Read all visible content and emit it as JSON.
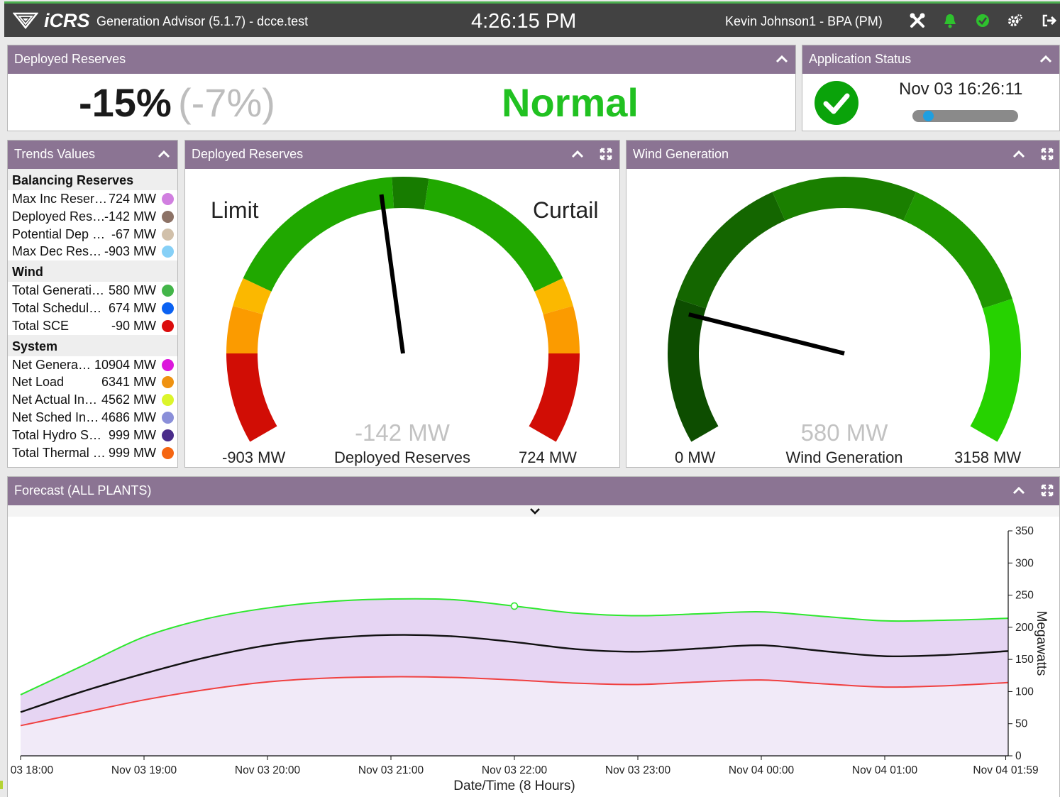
{
  "header": {
    "brand": "iCRS",
    "app_title": "Generation Advisor (5.1.7) - dcce.test",
    "clock": "4:26:15 PM",
    "user": "Kevin Johnson1 - BPA (PM)"
  },
  "deployed_summary": {
    "title": "Deployed Reserves",
    "percent": "-15%",
    "percent_paren": "(-7%)",
    "status": "Normal",
    "status_color": "#21c121"
  },
  "app_status": {
    "title": "Application Status",
    "timestamp": "Nov 03 16:26:11",
    "progress": 0.1
  },
  "trends": {
    "title": "Trends Values",
    "groups": [
      {
        "name": "Balancing Reserves",
        "rows": [
          {
            "label": "Max Inc Reser…",
            "value": "724 MW",
            "color": "#d17fe0"
          },
          {
            "label": "Deployed Res…",
            "value": "-142 MW",
            "color": "#8c7266"
          },
          {
            "label": "Potential Dep …",
            "value": "-67 MW",
            "color": "#d1c0aa"
          },
          {
            "label": "Max Dec Res…",
            "value": "-903 MW",
            "color": "#86d0f7"
          }
        ]
      },
      {
        "name": "Wind",
        "rows": [
          {
            "label": "Total Generati…",
            "value": "580 MW",
            "color": "#43b549"
          },
          {
            "label": "Total Schedul…",
            "value": "674 MW",
            "color": "#0b62f2"
          },
          {
            "label": "Total SCE",
            "value": "-90 MW",
            "color": "#db0d0d"
          }
        ]
      },
      {
        "name": "System",
        "rows": [
          {
            "label": "Net Genera…",
            "value": "10904 MW",
            "color": "#dc18dc"
          },
          {
            "label": "Net Load",
            "value": "6341 MW",
            "color": "#ef9211"
          },
          {
            "label": "Net Actual In…",
            "value": "4562 MW",
            "color": "#dcf52b"
          },
          {
            "label": "Net Sched In…",
            "value": "4686 MW",
            "color": "#8a8fd9"
          },
          {
            "label": "Total Hydro S…",
            "value": "999 MW",
            "color": "#4a2c8a"
          },
          {
            "label": "Total Thermal …",
            "value": "999 MW",
            "color": "#f56612"
          }
        ]
      }
    ]
  },
  "deployed_gauge": {
    "title": "Deployed Reserves",
    "left_label": "Limit",
    "right_label": "Curtail",
    "value_text": "-142 MW",
    "caption": "Deployed Reserves",
    "min_text": "-903 MW",
    "max_text": "724 MW",
    "min": -903,
    "max": 724,
    "value": -142,
    "colors": {
      "red": "#d10d05",
      "orange": "#fb9b00",
      "amber": "#fbb800",
      "green": "#20a800",
      "dark_green": "#177c00"
    }
  },
  "wind_gauge": {
    "title": "Wind Generation",
    "value_text": "580 MW",
    "caption": "Wind Generation",
    "min_text": "0 MW",
    "max_text": "3158 MW",
    "min": 0,
    "max": 3158,
    "value": 580,
    "colors": [
      "#0d4d00",
      "#146600",
      "#1a7f00",
      "#1f9800",
      "#26d200"
    ]
  },
  "forecast": {
    "title": "Forecast (ALL PLANTS)",
    "chart_data": {
      "type": "area",
      "xlabel": "Date/Time (8 Hours)",
      "ylabel": "Megawatts",
      "ylim": [
        0,
        350
      ],
      "yticks": [
        0,
        50,
        100,
        150,
        200,
        250,
        300,
        350
      ],
      "x_tick_labels": [
        "Nov 03 18:00",
        "Nov 03 19:00",
        "Nov 03 20:00",
        "Nov 03 21:00",
        "Nov 03 22:00",
        "Nov 03 23:00",
        "Nov 04 00:00",
        "Nov 04 01:00",
        "Nov 04 01:59"
      ],
      "x_hours": [
        0,
        1,
        2,
        3,
        4,
        5,
        6,
        7,
        7.98
      ],
      "series": [
        {
          "role": "upper",
          "color": "#2ee82e",
          "x": [
            0,
            0.5,
            1,
            1.5,
            2,
            2.5,
            3,
            3.5,
            4,
            4.5,
            5,
            5.5,
            6,
            6.5,
            7,
            7.5,
            8
          ],
          "y": [
            95,
            140,
            185,
            213,
            230,
            240,
            244,
            243,
            233,
            222,
            218,
            221,
            224,
            217,
            210,
            211,
            214
          ]
        },
        {
          "role": "center",
          "color": "#111111",
          "x": [
            0,
            0.5,
            1,
            1.5,
            2,
            2.5,
            3,
            3.5,
            4,
            4.5,
            5,
            5.5,
            6,
            6.5,
            7,
            7.5,
            8
          ],
          "y": [
            68,
            100,
            128,
            153,
            172,
            183,
            188,
            186,
            177,
            166,
            162,
            167,
            172,
            163,
            155,
            157,
            163
          ]
        },
        {
          "role": "lower",
          "color": "#f04040",
          "x": [
            0,
            0.5,
            1,
            1.5,
            2,
            2.5,
            3,
            3.5,
            4,
            4.5,
            5,
            5.5,
            6,
            6.5,
            7,
            7.5,
            8
          ],
          "y": [
            47,
            67,
            87,
            103,
            115,
            121,
            123,
            122,
            118,
            113,
            111,
            115,
            118,
            112,
            107,
            109,
            114
          ]
        }
      ],
      "marker_x": 4,
      "fill_band": "#e6d5f3",
      "fill_base": "#f1eaf8"
    }
  }
}
